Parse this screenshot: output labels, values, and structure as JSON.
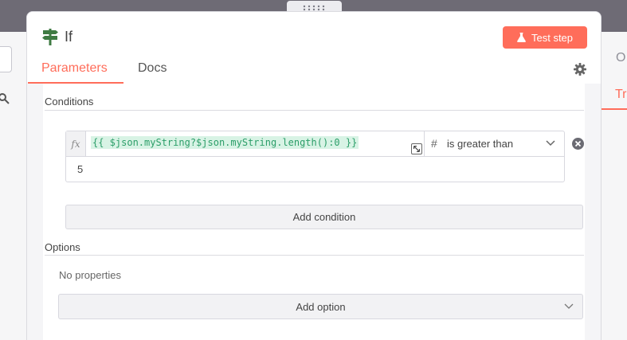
{
  "node": {
    "title": "If"
  },
  "toolbar": {
    "test_step_label": "Test step"
  },
  "tabs": [
    {
      "label": "Parameters",
      "active": true
    },
    {
      "label": "Docs",
      "active": false
    }
  ],
  "conditions": {
    "section_label": "Conditions",
    "rows": [
      {
        "fx_label": "fx",
        "expression": "{{ $json.myString?$json.myString.length():0 }}",
        "operator_type_icon": "#",
        "operator_label": "is greater than",
        "value": "5"
      }
    ],
    "add_label": "Add condition"
  },
  "options": {
    "section_label": "Options",
    "empty_text": "No properties",
    "add_label": "Add option"
  },
  "right_panel": {
    "tab_partial": "Tr",
    "header_partial": "O"
  },
  "colors": {
    "accent": "#ff6d5a",
    "expression_text": "#2c9e69",
    "expression_bg": "#d8f3e5"
  }
}
